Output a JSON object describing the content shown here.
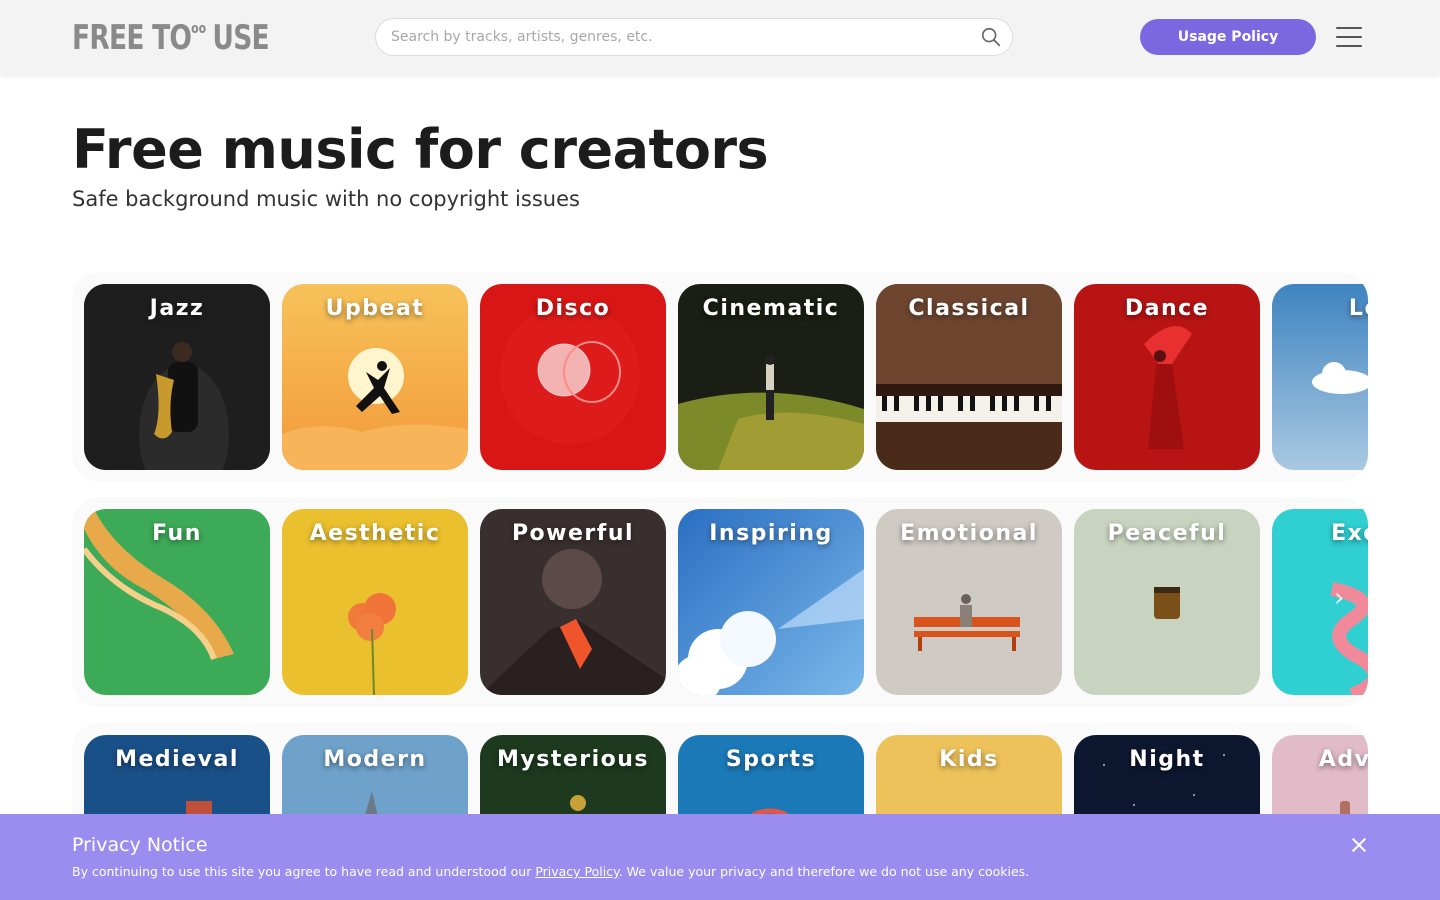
{
  "header": {
    "logo_text": "FREE TO",
    "logo_sup": "oo",
    "logo_text_end": "USE",
    "search_placeholder": "Search by tracks, artists, genres, etc.",
    "usage_policy_label": "Usage Policy",
    "icons": [
      "search-icon",
      "hamburger-menu-icon"
    ]
  },
  "hero": {
    "title": "Free music for creators",
    "subtitle": "Safe background music with no copyright issues"
  },
  "rows": [
    {
      "cards": [
        {
          "label": "Jazz",
          "color": "#1f1f1f"
        },
        {
          "label": "Upbeat",
          "color": "#f4a43a"
        },
        {
          "label": "Disco",
          "color": "#d61414"
        },
        {
          "label": "Cinematic",
          "color": "#2a3a1a"
        },
        {
          "label": "Classical",
          "color": "#5a3520"
        },
        {
          "label": "Dance",
          "color": "#b51212"
        },
        {
          "label": "Lo",
          "color": "#5d94c4"
        }
      ]
    },
    {
      "cards": [
        {
          "label": "Fun",
          "color": "#3aa356"
        },
        {
          "label": "Aesthetic",
          "color": "#e9c233"
        },
        {
          "label": "Powerful",
          "color": "#3a2e2e"
        },
        {
          "label": "Inspiring",
          "color": "#2f77c8"
        },
        {
          "label": "Emotional",
          "color": "#c9c4bf"
        },
        {
          "label": "Peaceful",
          "color": "#c7d3bd"
        },
        {
          "label": "Excit",
          "color": "#2ed0d0"
        }
      ]
    },
    {
      "cards": [
        {
          "label": "Medieval",
          "color": "#1b4f86"
        },
        {
          "label": "Modern",
          "color": "#6ea0c8"
        },
        {
          "label": "Mysterious",
          "color": "#1d3a1e"
        },
        {
          "label": "Sports",
          "color": "#1a78b8"
        },
        {
          "label": "Kids",
          "color": "#eec35a"
        },
        {
          "label": "Night",
          "color": "#101830"
        },
        {
          "label": "Advert",
          "color": "#e0b9c6"
        }
      ]
    }
  ],
  "privacy": {
    "title": "Privacy Notice",
    "text_before": "By continuing to use this site you agree to have read and understood our ",
    "link": "Privacy Policy",
    "text_after": ". We value your privacy and therefore we do not use any cookies."
  }
}
